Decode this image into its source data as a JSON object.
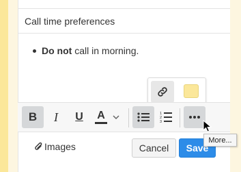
{
  "note": {
    "title": "Call time preferences",
    "content": {
      "bold_text": "Do not",
      "rest_text": " call in morning."
    }
  },
  "popover": {
    "link_icon": "link-icon",
    "color_swatch": "#fbe79a"
  },
  "toolbar": {
    "bold_label": "B",
    "italic_label": "I",
    "underline_label": "U",
    "text_color_label": "A",
    "icons": [
      "bold-icon",
      "italic-icon",
      "underline-icon",
      "text-color-icon",
      "bulleted-list-icon",
      "numbered-list-icon",
      "more-icon"
    ]
  },
  "footer": {
    "images_label": "Images",
    "cancel_label": "Cancel",
    "save_label": "Save"
  },
  "tooltip": {
    "text": "More..."
  },
  "colors": {
    "accent": "#2d8ce8",
    "note_yellow": "#fbe79a",
    "active_button": "#d5d7d9"
  }
}
